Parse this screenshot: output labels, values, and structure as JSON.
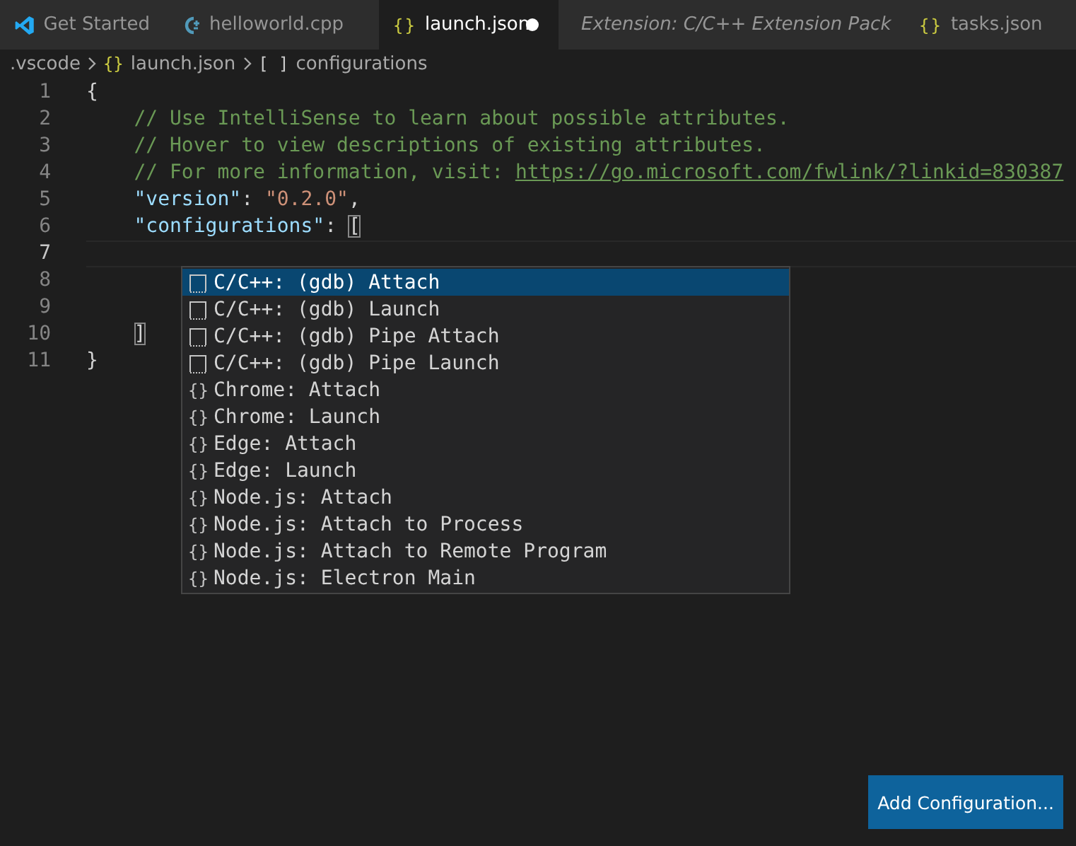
{
  "tabs": [
    {
      "label": "Get Started",
      "kind": "vscode",
      "selected": false,
      "dirty": false,
      "preview": false
    },
    {
      "label": "helloworld.cpp",
      "kind": "cpp",
      "selected": false,
      "dirty": false,
      "preview": false
    },
    {
      "label": "launch.json",
      "kind": "json",
      "icon_text": "{}",
      "selected": true,
      "dirty": true,
      "preview": false
    },
    {
      "label": "Extension: C/C++ Extension Pack",
      "kind": "preview",
      "selected": false,
      "dirty": false,
      "preview": true
    },
    {
      "label": "tasks.json",
      "kind": "json",
      "icon_text": "{}",
      "selected": false,
      "dirty": false,
      "preview": false
    }
  ],
  "breadcrumb": [
    {
      "label": ".vscode"
    },
    {
      "icon_text": "{}",
      "label": "launch.json"
    },
    {
      "icon_text": "[ ]",
      "label": "configurations"
    }
  ],
  "editor": {
    "lines": [
      {
        "number": "1",
        "current": false,
        "tokens": [
          {
            "kind": "punct",
            "text": "{"
          }
        ]
      },
      {
        "number": "2",
        "current": false,
        "tokens": [
          {
            "kind": "comment",
            "text": "    // Use IntelliSense to learn about possible attributes."
          }
        ]
      },
      {
        "number": "3",
        "current": false,
        "tokens": [
          {
            "kind": "comment",
            "text": "    // Hover to view descriptions of existing attributes."
          }
        ]
      },
      {
        "number": "4",
        "current": false,
        "tokens": [
          {
            "kind": "comment",
            "text": "    // For more information, visit: "
          },
          {
            "kind": "link",
            "text": "https://go.microsoft.com/fwlink/?linkid=830387"
          }
        ]
      },
      {
        "number": "5",
        "current": false,
        "tokens": [
          {
            "kind": "key",
            "text": "    \"version\""
          },
          {
            "kind": "punct",
            "text": ": "
          },
          {
            "kind": "string",
            "text": "\"0.2.0\""
          },
          {
            "kind": "punct",
            "text": ","
          }
        ]
      },
      {
        "number": "6",
        "current": false,
        "tokens": [
          {
            "kind": "key",
            "text": "    \"configurations\""
          },
          {
            "kind": "punct",
            "text": ": "
          },
          {
            "kind": "bracket",
            "text": "["
          }
        ]
      },
      {
        "number": "7",
        "current": true
      },
      {
        "number": "8",
        "current": false
      },
      {
        "number": "9",
        "current": false
      },
      {
        "number": "10",
        "current": false,
        "tokens": [
          {
            "kind": "bracket",
            "text": "    ]"
          }
        ]
      },
      {
        "number": "11",
        "current": false,
        "tokens": [
          {
            "kind": "punct",
            "text": "}"
          }
        ]
      }
    ]
  },
  "suggestions": [
    {
      "kind": "snippet",
      "label": "C/C++: (gdb) Attach",
      "selected": true
    },
    {
      "kind": "snippet",
      "label": "C/C++: (gdb) Launch",
      "selected": false
    },
    {
      "kind": "snippet",
      "label": "C/C++: (gdb) Pipe Attach",
      "selected": false
    },
    {
      "kind": "snippet",
      "label": "C/C++: (gdb) Pipe Launch",
      "selected": false
    },
    {
      "kind": "braces",
      "icon_text": "{}",
      "label": "Chrome: Attach",
      "selected": false
    },
    {
      "kind": "braces",
      "icon_text": "{}",
      "label": "Chrome: Launch",
      "selected": false
    },
    {
      "kind": "braces",
      "icon_text": "{}",
      "label": "Edge: Attach",
      "selected": false
    },
    {
      "kind": "braces",
      "icon_text": "{}",
      "label": "Edge: Launch",
      "selected": false
    },
    {
      "kind": "braces",
      "icon_text": "{}",
      "label": "Node.js: Attach",
      "selected": false
    },
    {
      "kind": "braces",
      "icon_text": "{}",
      "label": "Node.js: Attach to Process",
      "selected": false
    },
    {
      "kind": "braces",
      "icon_text": "{}",
      "label": "Node.js: Attach to Remote Program",
      "selected": false
    },
    {
      "kind": "braces",
      "icon_text": "{}",
      "label": "Node.js: Electron Main",
      "selected": false
    }
  ],
  "add_button": {
    "label": "Add Configuration..."
  }
}
